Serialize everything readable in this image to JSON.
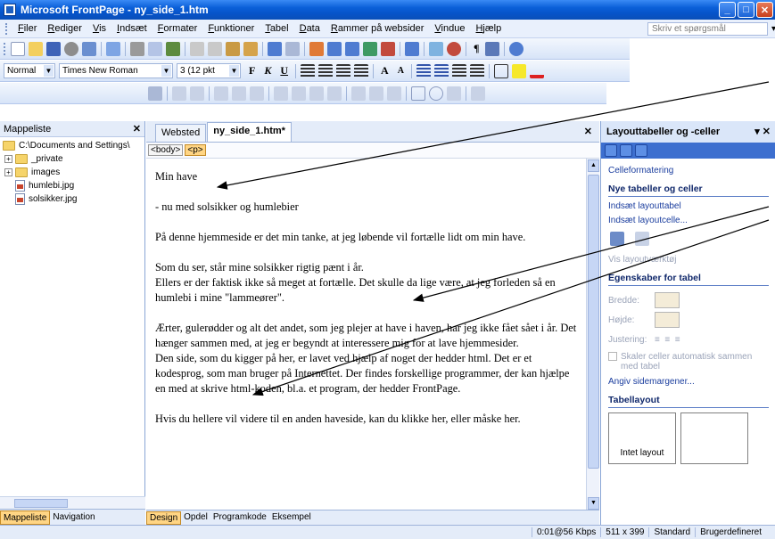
{
  "window": {
    "title": "Microsoft FrontPage - ny_side_1.htm",
    "buttons": [
      "minimize",
      "maximize",
      "close"
    ]
  },
  "menu": {
    "items": [
      "Filer",
      "Rediger",
      "Vis",
      "Indsæt",
      "Formater",
      "Funktioner",
      "Tabel",
      "Data",
      "Rammer på websider",
      "Vindue",
      "Hjælp"
    ],
    "help_placeholder": "Skriv et spørgsmål"
  },
  "formatting": {
    "style": "Normal",
    "font": "Times New Roman",
    "size": "3 (12 pkt",
    "bold": "F",
    "italic": "K",
    "underline": "U"
  },
  "left_panel": {
    "title": "Mappeliste",
    "root": "C:\\Documents and Settings\\",
    "items": [
      {
        "type": "folder",
        "label": "_private"
      },
      {
        "type": "folder",
        "label": "images"
      },
      {
        "type": "file",
        "label": "humlebi.jpg"
      },
      {
        "type": "file",
        "label": "solsikker.jpg"
      }
    ],
    "tabs": [
      "Mappeliste",
      "Navigation"
    ]
  },
  "document": {
    "tabs": [
      "Websted",
      "ny_side_1.htm*"
    ],
    "tags": [
      "<body>",
      "<p>"
    ],
    "paragraphs": [
      "Min have",
      "",
      "- nu med solsikker og humlebier",
      "",
      "På denne hjemmeside er det min tanke, at jeg løbende vil fortælle lidt om min have.",
      "",
      "Som du ser, står mine solsikker rigtig pænt i år.",
      "Ellers er der faktisk ikke så meget at fortælle. Det skulle da lige være, at jeg forleden så en humlebi i mine \"lammeører\".",
      "",
      "Ærter, gulerødder og alt det andet, som jeg plejer at have i haven, har jeg ikke fået sået i år. Det hænger sammen med, at jeg er begyndt at interessere mig for at lave hjemmesider.",
      "Den side, som du kigger på her, er lavet ved hjælp af noget der hedder html. Det er et kodesprog, som man bruger på Internettet. Der findes forskellige programmer, der kan hjælpe en med at skrive html-koden, bl.a. et program, der hedder FrontPage.",
      "",
      "Hvis du hellere vil videre til en anden haveside, kan du klikke her, eller måske her."
    ],
    "view_tabs": [
      "Design",
      "Opdel",
      "Programkode",
      "Eksempel"
    ]
  },
  "task_pane": {
    "title": "Layouttabeller og -celler",
    "cell_format": "Celleformatering",
    "section_new": "Nye tabeller og celler",
    "insert_table": "Indsæt layouttabel",
    "insert_cell": "Indsæt layoutcelle...",
    "show_tools": "Vis layoutværktøj",
    "section_props": "Egenskaber for tabel",
    "width_label": "Bredde:",
    "height_label": "Højde:",
    "align_label": "Justering:",
    "scale_label": "Skaler celler automatisk sammen med tabel",
    "margins_link": "Angiv sidemargener...",
    "section_layout": "Tabellayout",
    "no_layout": "Intet layout"
  },
  "status": {
    "speed": "0:01@56 Kbps",
    "dimensions": "511 x 399",
    "mode": "Standard",
    "custom": "Brugerdefineret"
  }
}
